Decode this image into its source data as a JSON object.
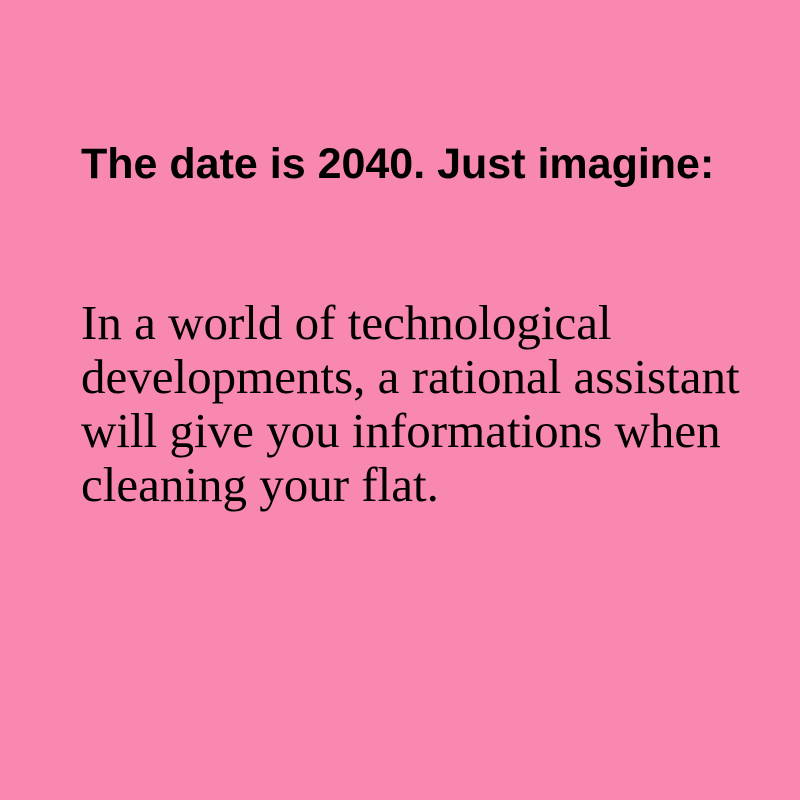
{
  "card": {
    "background_color": "#f888b0",
    "headline": "The date is 2040. Just imagine:",
    "body": "In a world of technological developments, a rational assistant will give you informations when cleaning your flat."
  }
}
